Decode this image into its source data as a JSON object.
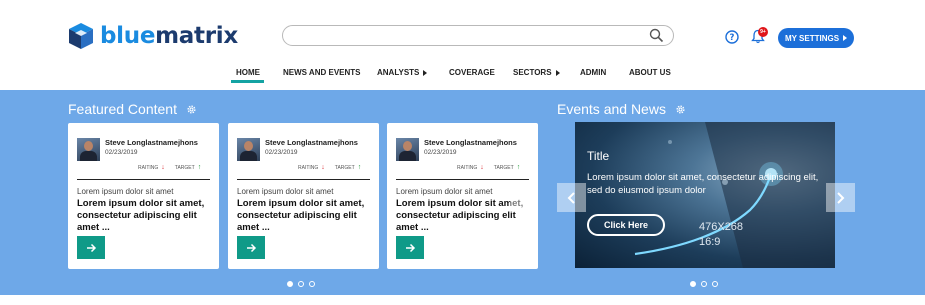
{
  "brand": {
    "logo_part1": "blue",
    "logo_part2": "matrix",
    "blue_color": "#1a8be0",
    "dark_color": "#1c3b6e"
  },
  "search": {
    "placeholder": "",
    "icon": "search-icon"
  },
  "header": {
    "help_icon": "question-circle-icon",
    "bell_icon": "bell-icon",
    "notification_count": "9+",
    "settings_label": "MY SETTINGS"
  },
  "nav": {
    "items": [
      {
        "label": "HOME",
        "active": true
      },
      {
        "label": "NEWS AND EVENTS"
      },
      {
        "label": "ANALYSTS",
        "dropdown": true
      },
      {
        "label": "COVERAGE"
      },
      {
        "label": "SECTORS",
        "dropdown": true
      },
      {
        "label": "ADMIN"
      },
      {
        "label": "ABOUT US"
      }
    ],
    "active_color": "#14a3a3"
  },
  "featured": {
    "title": "Featured Content",
    "cards": [
      {
        "author": "Steve Longlastnamejhons",
        "date": "02/23/2019",
        "rating_label": "RAITING",
        "target_label": "TARGET",
        "subtitle": "Lorem ipsum dolor sit amet",
        "title": "Lorem ipsum dolor sit amet, consectetur adipiscing elit amet ..."
      },
      {
        "author": "Steve Longlastnamejhons",
        "date": "02/23/2019",
        "rating_label": "RAITING",
        "target_label": "TARGET",
        "subtitle": "Lorem ipsum dolor sit amet",
        "title": "Lorem ipsum dolor sit amet, consectetur adipiscing elit amet ..."
      },
      {
        "author": "Steve Longlastnamejhons",
        "date": "02/23/2019",
        "rating_label": "RAITING",
        "target_label": "TARGET",
        "subtitle": "Lorem ipsum dolor sit amet",
        "title": "Lorem ipsum dolor sit amet, consectetur adipiscing elit amet ..."
      }
    ],
    "card_title_display": "Lorem ipsum dolor sit amet, consectetur adipiscing elit amet ...",
    "button_color": "#0f9a88",
    "pager_total": 3,
    "pager_active": 1
  },
  "events": {
    "title": "Events and News",
    "slide_title": "Title",
    "slide_text": "Lorem ipsum dolor sit amet, consectetur adipiscing elit, sed do eiusmod  ipsum dolor",
    "button_label": "Click Here",
    "image_size_line1": "476X268",
    "image_size_line2": "16:9",
    "pager_total": 3,
    "pager_active": 1
  },
  "band_color": "#6ea8e8"
}
